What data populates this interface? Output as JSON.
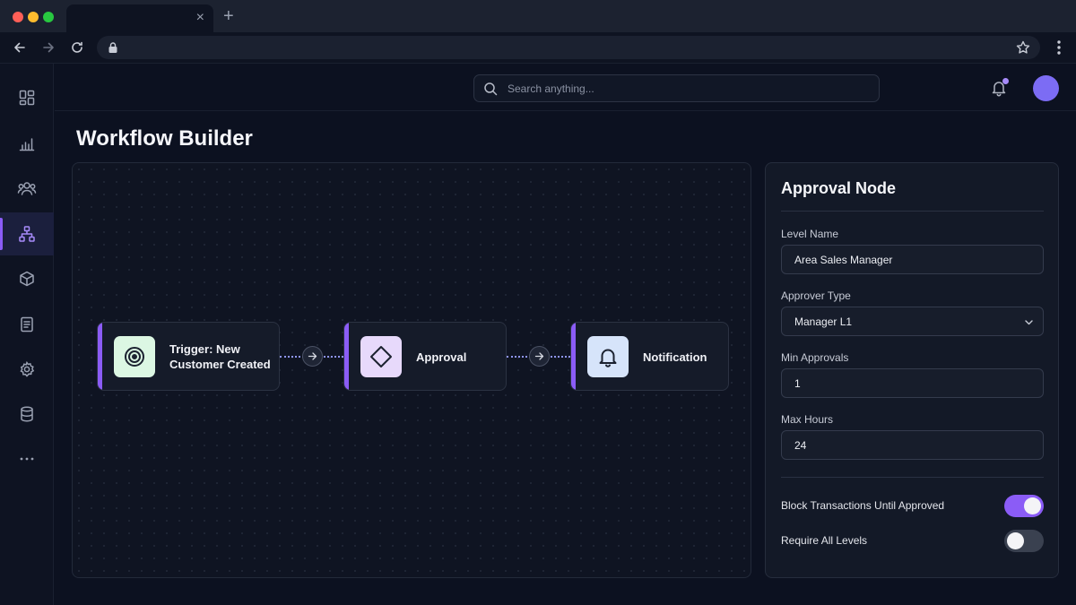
{
  "browser": {
    "traffic_light_colors": [
      "#ff5f57",
      "#febc2e",
      "#28c840"
    ],
    "tab_close": "×",
    "new_tab": "+"
  },
  "sidebar": {
    "items": [
      {
        "icon": "dashboard-icon",
        "active": false
      },
      {
        "icon": "bar-chart-icon",
        "active": false
      },
      {
        "icon": "users-icon",
        "active": false
      },
      {
        "icon": "workflow-icon",
        "active": true
      },
      {
        "icon": "box-icon",
        "active": false
      },
      {
        "icon": "document-icon",
        "active": false
      },
      {
        "icon": "gear-icon",
        "active": false
      },
      {
        "icon": "database-icon",
        "active": false
      },
      {
        "icon": "more-icon",
        "active": false
      }
    ],
    "more_label": "···"
  },
  "header": {
    "search_placeholder": "Search anything...",
    "notification_dot_color": "#a78bfa",
    "avatar_color": "#7c6cf4"
  },
  "page": {
    "title": "Workflow Builder"
  },
  "workflow": {
    "nodes": [
      {
        "line1": "Trigger: New",
        "line2": "Customer Created",
        "icon": "target-icon",
        "icon_bg": "#dcf7e3"
      },
      {
        "line1": "Approval",
        "line2": "",
        "icon": "diamond-icon",
        "icon_bg": "#e7d9fb"
      },
      {
        "line1": "Notification",
        "line2": "",
        "icon": "bell-icon",
        "icon_bg": "#d6e4fa"
      }
    ],
    "accent_color": "#8b5cf6",
    "connector_color": "#8f95f5"
  },
  "panel": {
    "title": "Approval Node",
    "fields": {
      "level_name": {
        "label": "Level Name",
        "value": "Area Sales Manager"
      },
      "approver_type": {
        "label": "Approver Type",
        "value": "Manager L1"
      },
      "min_approvals": {
        "label": "Min Approvals",
        "value": "1"
      },
      "max_hours": {
        "label": "Max Hours",
        "value": "24"
      }
    },
    "toggles": {
      "block_transactions": {
        "label": "Block Transactions Until Approved",
        "on": true
      },
      "require_all_levels": {
        "label": "Require All Levels",
        "on": false
      }
    },
    "toggle_on_color": "#8b5cf6",
    "toggle_off_color": "#3a4150"
  }
}
